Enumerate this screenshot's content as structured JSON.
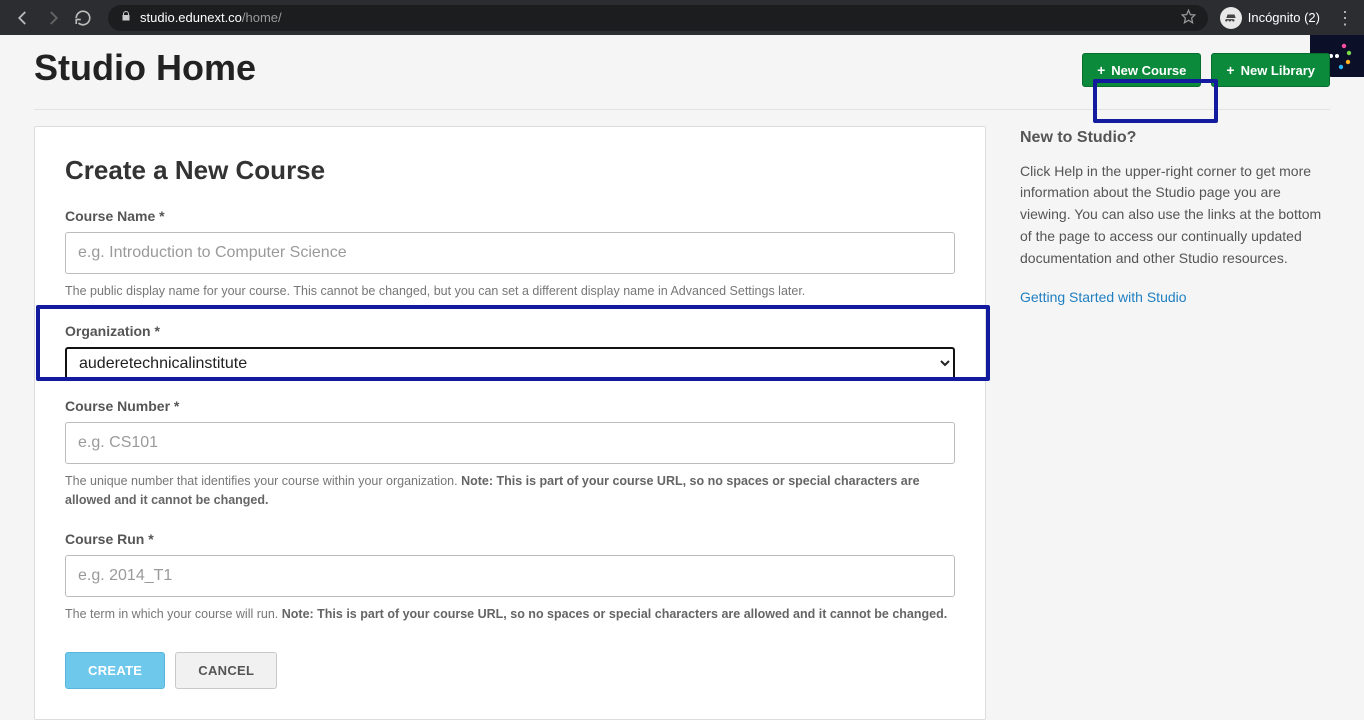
{
  "browser": {
    "url_host": "studio.edunext.co",
    "url_path": "/home/",
    "incognito_label": "Incógnito (2)"
  },
  "header": {
    "page_title": "Studio Home",
    "new_course_label": "New Course",
    "new_library_label": "New Library"
  },
  "form": {
    "panel_title": "Create a New Course",
    "course_name": {
      "label": "Course Name",
      "placeholder": "e.g. Introduction to Computer Science",
      "value": "",
      "helper": "The public display name for your course. This cannot be changed, but you can set a different display name in Advanced Settings later."
    },
    "organization": {
      "label": "Organization",
      "selected": "auderetechnicalinstitute"
    },
    "course_number": {
      "label": "Course Number",
      "placeholder": "e.g. CS101",
      "value": "",
      "helper_plain": "The unique number that identifies your course within your organization. ",
      "helper_bold": "Note: This is part of your course URL, so no spaces or special characters are allowed and it cannot be changed."
    },
    "course_run": {
      "label": "Course Run",
      "placeholder": "e.g. 2014_T1",
      "value": "",
      "helper_plain": "The term in which your course will run. ",
      "helper_bold": "Note: This is part of your course URL, so no spaces or special characters are allowed and it cannot be changed."
    },
    "buttons": {
      "create": "CREATE",
      "cancel": "CANCEL"
    },
    "required_mark": "*"
  },
  "sidebar": {
    "title": "New to Studio?",
    "body": "Click Help in the upper-right corner to get more information about the Studio page you are viewing. You can also use the links at the bottom of the page to access our continually updated documentation and other Studio resources.",
    "link": "Getting Started with Studio"
  }
}
